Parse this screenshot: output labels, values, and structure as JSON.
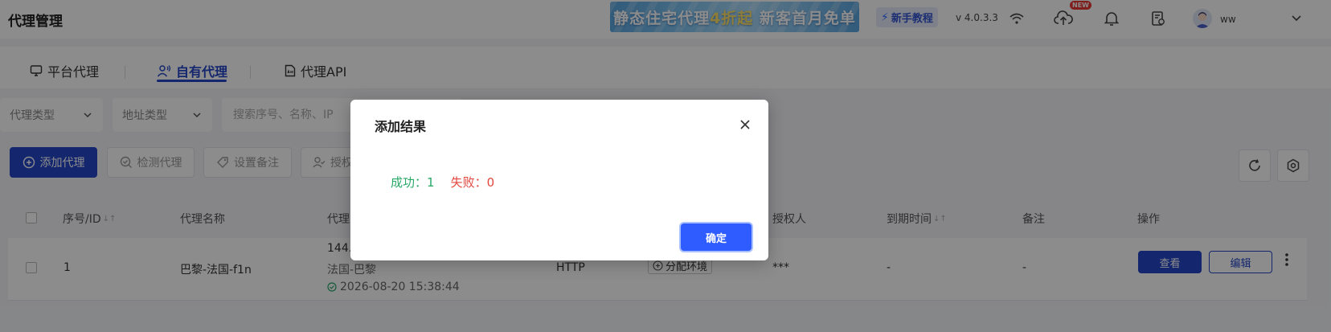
{
  "header": {
    "title": "代理管理",
    "banner": {
      "text_main": "静态住宅代理",
      "text_accent": "4折起",
      "text_tail": " 新客首月免单"
    },
    "tutorial_label": "新手教程",
    "version": "v 4.0.3.3",
    "new_badge": "NEW",
    "username": "ww",
    "icons": [
      "wifi-icon",
      "cloud-upload-icon",
      "bell-icon",
      "document-settings-icon",
      "user-avatar",
      "chevron-down-icon"
    ]
  },
  "tabs": [
    {
      "label": "平台代理",
      "icon": "monitor-icon",
      "active": false
    },
    {
      "label": "自有代理",
      "icon": "user-broadcast-icon",
      "active": true
    },
    {
      "label": "代理API",
      "icon": "api-doc-icon",
      "active": false
    }
  ],
  "filters": {
    "proxy_type": "代理类型",
    "address_type": "地址类型",
    "search_placeholder": "搜索序号、名称、IP"
  },
  "toolbar": {
    "add": "添加代理",
    "check": "检测代理",
    "remark": "设置备注",
    "auth": "授权"
  },
  "table": {
    "headers": {
      "id": "序号/ID",
      "name": "代理名称",
      "proxy": "代理",
      "authorizer": "授权人",
      "expire": "到期时间",
      "remark": "备注",
      "actions": "操作"
    },
    "rows": [
      {
        "id": "1",
        "name": "巴黎-法国-f1n",
        "ip_partial": "144.",
        "location": "法国-巴黎",
        "checked_at": "2026-08-20 15:38:44",
        "protocol": "HTTP",
        "env_label": "分配环境",
        "authorizer": "***",
        "expire": "-",
        "remark": "-",
        "view": "查看",
        "edit": "编辑"
      }
    ]
  },
  "modal": {
    "title": "添加结果",
    "success_label": "成功：",
    "success_count": "1",
    "failure_label": "失败：",
    "failure_count": "0",
    "confirm": "确定"
  },
  "colors": {
    "primary": "#2446c9",
    "confirm": "#2f5cff",
    "success": "#2aa868",
    "failure": "#e2463f"
  }
}
